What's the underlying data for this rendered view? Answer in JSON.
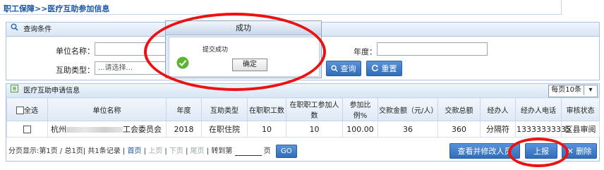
{
  "breadcrumb": "职工保障>>医疗互助参加信息",
  "query_panel": {
    "title": "查询条件",
    "unit_name_label": "单位名称：",
    "year_label": "年度：",
    "type_label": "互助类型：",
    "type_selected": "...请选择...",
    "search_label": "查询",
    "reset_label": "重置"
  },
  "list_panel": {
    "title": "医疗互助申请信息",
    "per_page": "每页10条",
    "columns": [
      "全选",
      "单位名称",
      "年度",
      "互助类型",
      "在职职工数",
      "在职职工参加人数",
      "参加比例%",
      "交款金额（元/人）",
      "交款总额",
      "经办人",
      "经办人电话",
      "审核状态"
    ],
    "rows": [
      {
        "unit_prefix": "杭州",
        "unit_suffix": "工会委员会",
        "year": "2018",
        "type": "在职住院",
        "staff": "10",
        "participants": "10",
        "ratio": "100.00",
        "amount": "36",
        "total": "360",
        "handler": "分隔符",
        "phone": "13333333335",
        "status": "区县审阅"
      }
    ],
    "pager": {
      "info": "分页显示:第1页 / 总1页| 共1条记录 |",
      "first": "首页",
      "prev": "上页",
      "next": "下页",
      "last": "尾页",
      "goto": "转到第",
      "page_unit": "页",
      "go": "GO"
    },
    "view_edit_label": "查看并修改人员",
    "submit_label": "上报",
    "delete_label": "删除"
  },
  "modal": {
    "title": "成功",
    "message": "提交成功",
    "ok_label": "确定"
  },
  "colors": {
    "accent": "#2f6cbc",
    "highlight_ring": "#ee1111",
    "success": "#5cb531"
  }
}
